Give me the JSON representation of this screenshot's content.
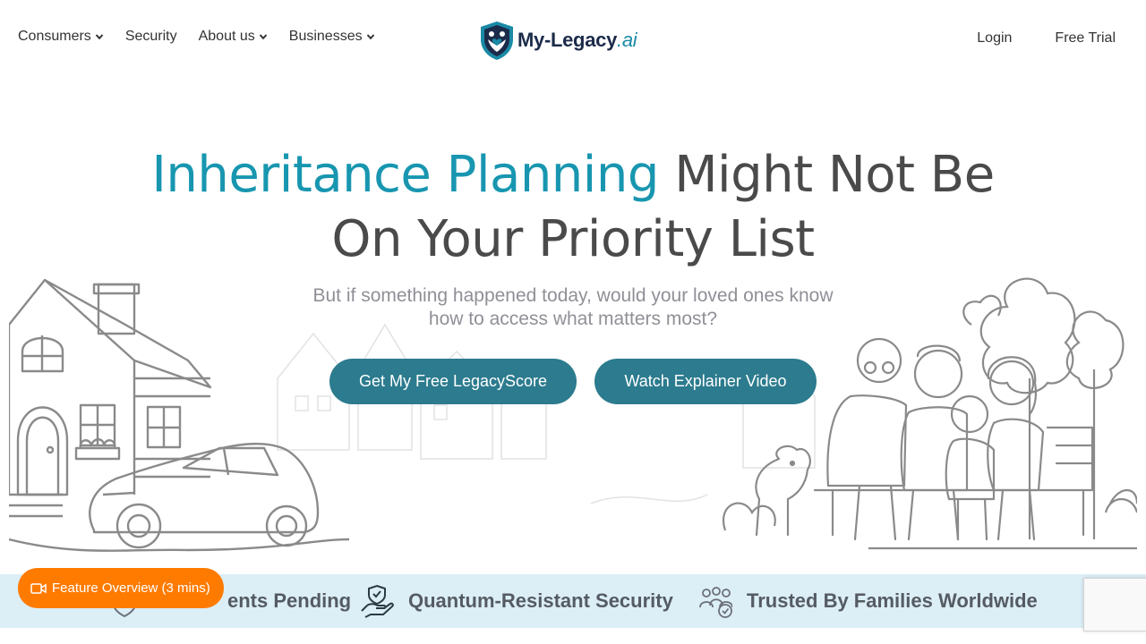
{
  "nav": {
    "left": [
      {
        "label": "Consumers",
        "dropdown": true
      },
      {
        "label": "Security",
        "dropdown": false
      },
      {
        "label": "About us",
        "dropdown": true
      },
      {
        "label": "Businesses",
        "dropdown": true
      }
    ],
    "logo": {
      "brand": "My-Legacy",
      "suffix": ".ai"
    },
    "right": {
      "login": "Login",
      "trial": "Free Trial"
    }
  },
  "hero": {
    "headline_accent": "Inheritance Planning",
    "headline_rest_1": "Might Not Be",
    "headline_line_2": "On Your Priority List",
    "subhead": "But if something happened today, would your loved ones know how to access what matters most?",
    "cta_primary": "Get My Free LegacyScore",
    "cta_secondary": "Watch Explainer Video"
  },
  "trust": {
    "item1": "ents Pending",
    "item2": "Quantum-Resistant Security",
    "item3": "Trusted By Families Worldwide"
  },
  "feature_button": "Feature Overview (3 mins)",
  "colors": {
    "accent": "#1896b0",
    "cta": "#2c7b8e",
    "trust_bar": "#dceef6",
    "feature_button": "#ff7b00",
    "brand_dark": "#1c2b4a"
  },
  "icons": [
    "chevron-down-icon",
    "logo-shield-icon",
    "shield-check-icon",
    "hand-shield-icon",
    "family-check-icon",
    "video-camera-icon"
  ]
}
